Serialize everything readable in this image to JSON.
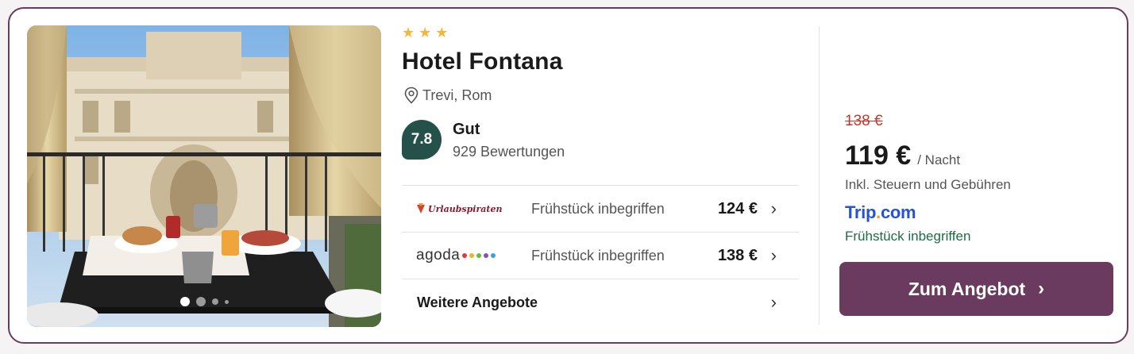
{
  "hotel": {
    "stars": 3,
    "name": "Hotel Fontana",
    "location": "Trevi, Rom",
    "rating": "7.8",
    "rating_word": "Gut",
    "reviews": "929 Bewertungen"
  },
  "gallery": {
    "total_dots": 4,
    "active_index": 0
  },
  "offers": [
    {
      "provider": "Urlaubspiraten",
      "description": "Frühstück inbegriffen",
      "price": "124 €"
    },
    {
      "provider": "agoda",
      "description": "Frühstück inbegriffen",
      "price": "138 €"
    }
  ],
  "more_offers_label": "Weitere Angebote",
  "deal": {
    "old_price": "138 €",
    "price": "119 €",
    "per_night": "/ Nacht",
    "taxes_note": "Inkl. Steuern und Gebühren",
    "provider_name_part1": "Trip",
    "provider_name_dot": ".",
    "provider_name_part2": "com",
    "breakfast": "Frühstück inbegriffen",
    "cta_label": "Zum Angebot"
  },
  "colors": {
    "brand": "#6b3a5f",
    "rating_badge": "#24514a",
    "old_price": "#c0392b",
    "breakfast_text": "#1d6b47",
    "trip_blue": "#2553d8",
    "star": "#f4b73a"
  },
  "icons": {
    "star": "star-icon",
    "location": "map-pin-icon",
    "chevron": "chevron-right-icon"
  }
}
